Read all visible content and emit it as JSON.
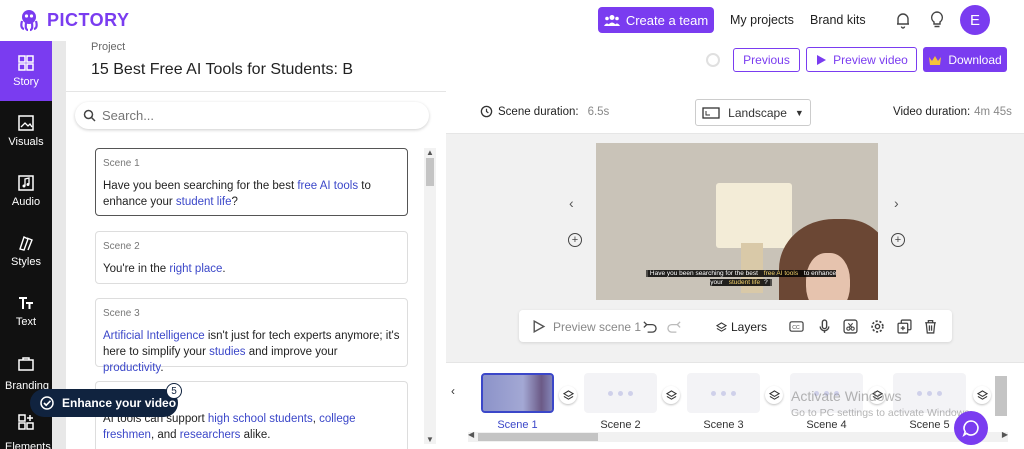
{
  "app": {
    "logo": "PICTORY"
  },
  "header": {
    "create_team": "Create a team",
    "my_projects": "My projects",
    "brand_kits": "Brand kits",
    "avatar_initial": "E"
  },
  "rail": {
    "items": [
      {
        "label": "Story",
        "icon": "story-icon"
      },
      {
        "label": "Visuals",
        "icon": "image-icon"
      },
      {
        "label": "Audio",
        "icon": "music-icon"
      },
      {
        "label": "Styles",
        "icon": "styles-icon"
      },
      {
        "label": "Text",
        "icon": "text-icon"
      }
    ],
    "partial_labels": [
      "Branding",
      "Elements"
    ]
  },
  "project": {
    "label": "Project",
    "title": "15 Best Free AI Tools for Students: B"
  },
  "search": {
    "placeholder": "Search..."
  },
  "scenes": [
    {
      "label": "Scene 1"
    },
    {
      "label": "Scene 2"
    },
    {
      "label": "Scene 3"
    },
    {
      "label": "Scene 4"
    }
  ],
  "scene_text": {
    "s1_a": "Have you been searching for the best ",
    "s1_b": "free AI tools",
    "s1_c": " to enhance your ",
    "s1_d": "student life",
    "s1_e": "?",
    "s2_a": "You're in the ",
    "s2_b": "right place",
    "s2_c": ".",
    "s3_a": "Artificial Intelligence",
    "s3_b": " isn't just for tech experts anymore; it's here to simplify your ",
    "s3_c": "studies",
    "s3_d": " and improve your ",
    "s3_e": "productivity",
    "s3_f": ".",
    "s4_a": "AI tools can support ",
    "s4_b": "high school students",
    "s4_c": ", ",
    "s4_d": "college freshmen",
    "s4_e": ", and ",
    "s4_f": "researchers",
    "s4_g": " alike."
  },
  "enhance": {
    "label": "Enhance your video",
    "badge": "5"
  },
  "actions": {
    "previous": "Previous",
    "preview_video": "Preview video",
    "download": "Download"
  },
  "info": {
    "scene_duration_label": "Scene duration:",
    "scene_duration_value": "6.5s",
    "orientation": "Landscape",
    "video_duration_label": "Video duration:",
    "video_duration_value": "4m 45s"
  },
  "video": {
    "caption_a": "Have you been searching for the best ",
    "caption_b": "free AI tools",
    "caption_c": " to enhance your ",
    "caption_d": "student life",
    "caption_e": "?"
  },
  "toolbar": {
    "preview_scene": "Preview scene 1",
    "layers": "Layers"
  },
  "timeline": {
    "scenes": [
      "Scene 1",
      "Scene 2",
      "Scene 3",
      "Scene 4",
      "Scene 5"
    ]
  },
  "watermark": {
    "line1": "Activate Windows",
    "line2": "Go to PC settings to activate Windows."
  },
  "colors": {
    "accent": "#7a3cf0",
    "link": "#3b47c9",
    "rail": "#111111",
    "enhance": "#10233f"
  }
}
